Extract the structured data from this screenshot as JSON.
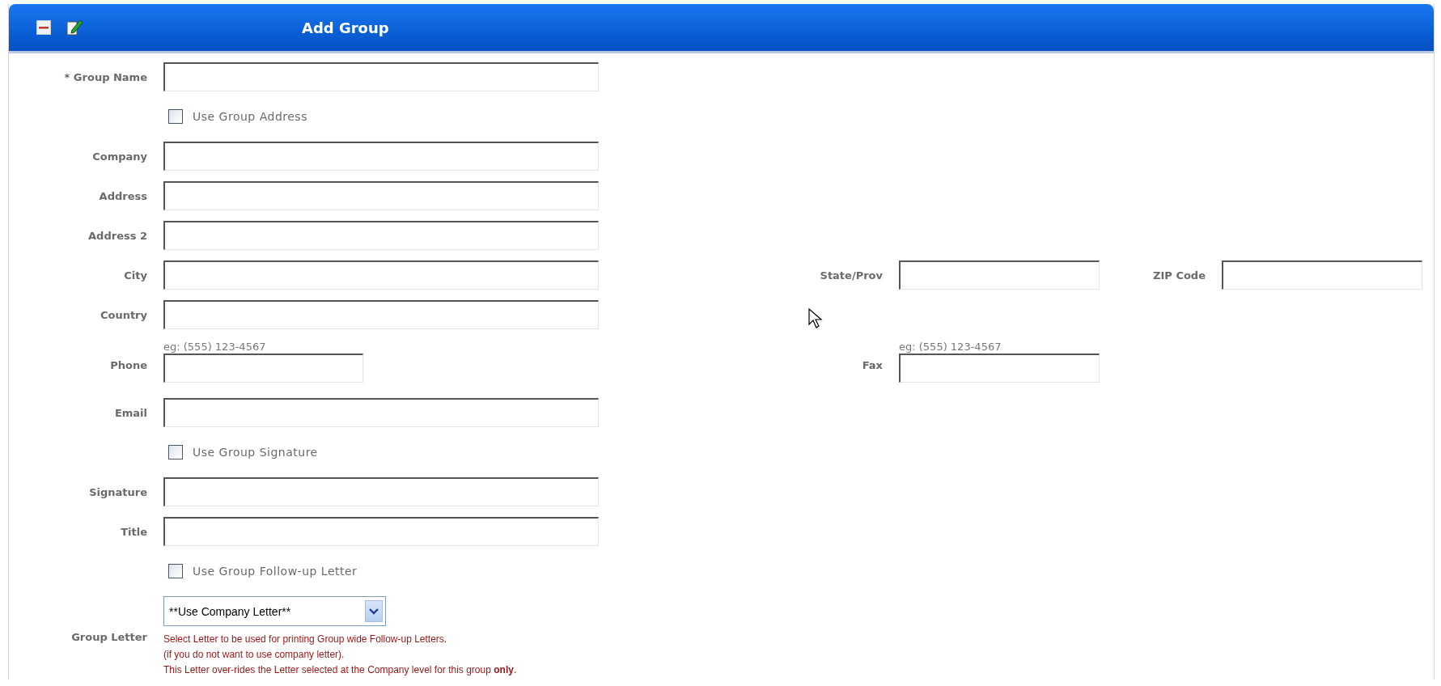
{
  "panel": {
    "title": "Add Group"
  },
  "rows": [
    {
      "kind": "field",
      "label": "* Group Name"
    },
    {
      "kind": "checkbox",
      "label": "Use Group Address",
      "checked": false
    },
    {
      "kind": "field",
      "label": "Company"
    },
    {
      "kind": "field",
      "label": "Address"
    },
    {
      "kind": "field",
      "label": "Address 2"
    },
    {
      "kind": "field",
      "label": "City",
      "extra": [
        {
          "label": "State/Prov"
        },
        {
          "label": "ZIP Code"
        }
      ]
    },
    {
      "kind": "field",
      "label": "Country"
    },
    {
      "kind": "hinted",
      "label": "Phone",
      "hint": "eg: (555) 123-4567",
      "extra": [
        {
          "label": "Fax",
          "hint": "eg: (555) 123-4567"
        }
      ]
    },
    {
      "kind": "field",
      "label": "Email"
    },
    {
      "kind": "checkbox",
      "label": "Use Group Signature",
      "checked": false
    },
    {
      "kind": "field",
      "label": "Signature"
    },
    {
      "kind": "field",
      "label": "Title"
    },
    {
      "kind": "checkbox",
      "label": "Use Group Follow-up Letter",
      "checked": false
    },
    {
      "kind": "select",
      "label": "Group Letter",
      "value": "**Use Company Letter**",
      "notes": [
        "Select Letter to be used for printing Group wide Follow-up Letters.",
        "(if you do not want to use company letter).",
        "This Letter over-rides the Letter selected at the Company level for this group **only**."
      ]
    }
  ]
}
